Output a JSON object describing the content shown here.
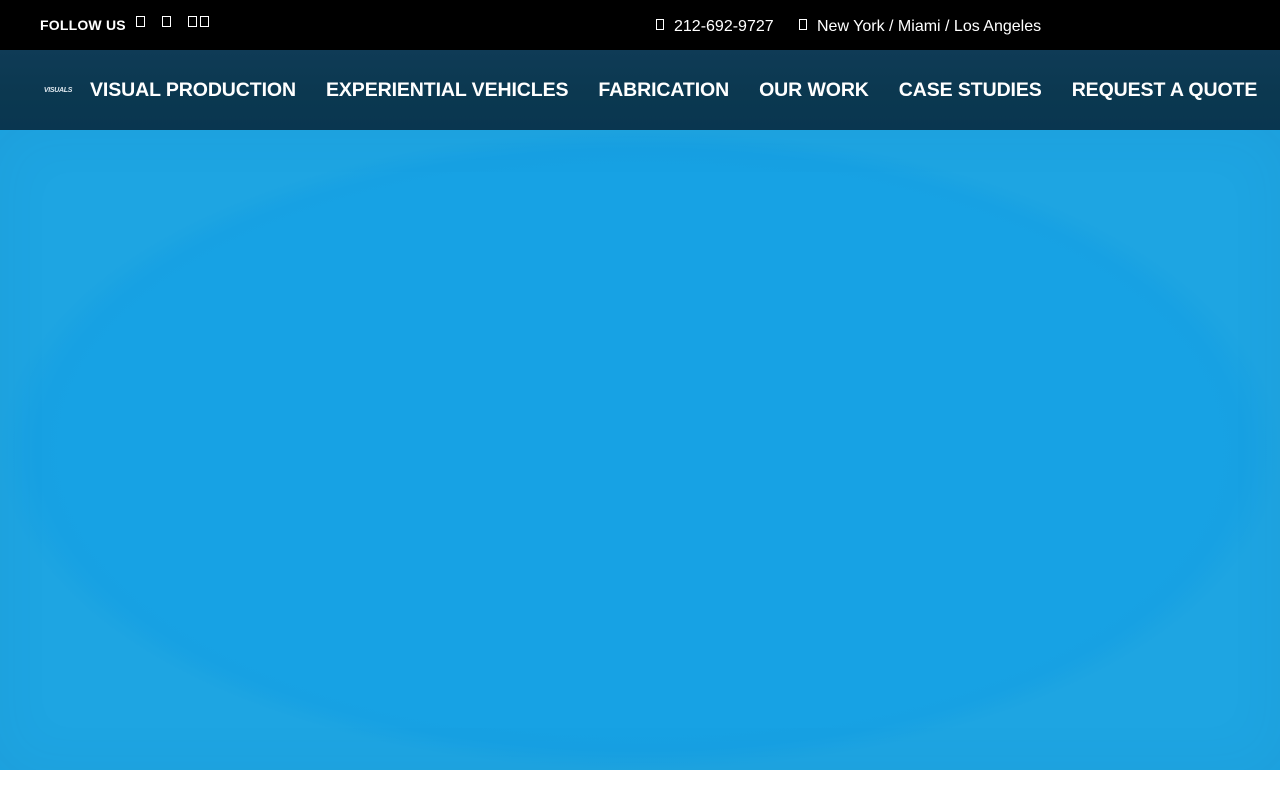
{
  "topbar": {
    "follow_label": "FOLLOW US",
    "social_icons": [
      "facebook-icon",
      "instagram-icon",
      "twitter-icon",
      "linkedin-icon"
    ],
    "phone": "212-692-9727",
    "phone_icon": "phone-icon",
    "locations": "New York / Miami / Los Angeles",
    "location_icon": "map-marker-icon"
  },
  "navbar": {
    "logo_text": "VISUALS",
    "items": [
      {
        "label": "VISUAL PRODUCTION"
      },
      {
        "label": "EXPERIENTIAL VEHICLES"
      },
      {
        "label": "FABRICATION"
      },
      {
        "label": "OUR WORK"
      },
      {
        "label": "CASE STUDIES"
      },
      {
        "label": "REQUEST A QUOTE"
      }
    ]
  },
  "colors": {
    "topbar_bg": "#000000",
    "navbar_bg": "#0c3953",
    "hero_bg": "#17a2e4",
    "text": "#ffffff"
  }
}
